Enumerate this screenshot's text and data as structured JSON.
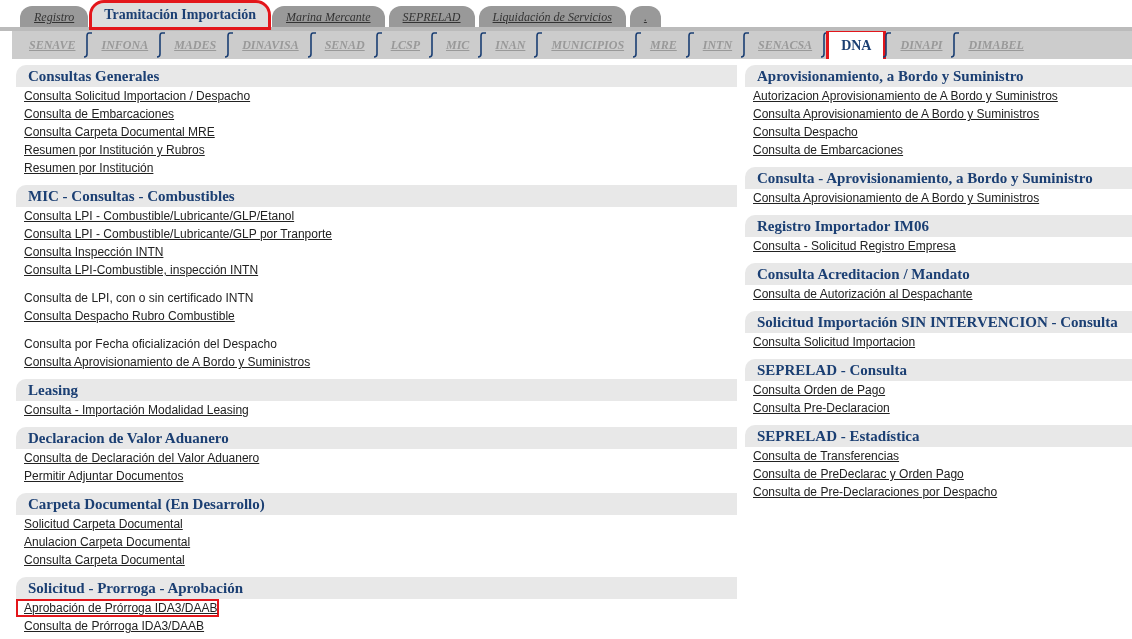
{
  "tabs": [
    {
      "label": "Registro",
      "selected": false,
      "highlighted": false
    },
    {
      "label": "Tramitación Importación",
      "selected": true,
      "highlighted": true
    },
    {
      "label": "Marina Mercante",
      "selected": false,
      "highlighted": false
    },
    {
      "label": "SEPRELAD",
      "selected": false,
      "highlighted": false
    },
    {
      "label": "Liquidación de Servicios",
      "selected": false,
      "highlighted": false
    },
    {
      "label": ".",
      "selected": false,
      "highlighted": false
    }
  ],
  "subtabs": [
    {
      "label": "SENAVE",
      "selected": false,
      "highlighted": false
    },
    {
      "label": "INFONA",
      "selected": false,
      "highlighted": false
    },
    {
      "label": "MADES",
      "selected": false,
      "highlighted": false
    },
    {
      "label": "DINAVISA",
      "selected": false,
      "highlighted": false
    },
    {
      "label": "SENAD",
      "selected": false,
      "highlighted": false
    },
    {
      "label": "LCSP",
      "selected": false,
      "highlighted": false
    },
    {
      "label": "MIC",
      "selected": false,
      "highlighted": false
    },
    {
      "label": "INAN",
      "selected": false,
      "highlighted": false
    },
    {
      "label": "MUNICIPIOS",
      "selected": false,
      "highlighted": false
    },
    {
      "label": "MRE",
      "selected": false,
      "highlighted": false
    },
    {
      "label": "INTN",
      "selected": false,
      "highlighted": false
    },
    {
      "label": "SENACSA",
      "selected": false,
      "highlighted": false
    },
    {
      "label": "DNA",
      "selected": true,
      "highlighted": true
    },
    {
      "label": "DINAPI",
      "selected": false,
      "highlighted": false
    },
    {
      "label": "DIMABEL",
      "selected": false,
      "highlighted": false
    }
  ],
  "columns": [
    {
      "sections": [
        {
          "title": "Consultas Generales",
          "items": [
            {
              "kind": "link",
              "text": "Consulta Solicitud Importacion / Despacho",
              "highlighted": false
            },
            {
              "kind": "link",
              "text": "Consulta de Embarcaciones",
              "highlighted": false
            },
            {
              "kind": "link",
              "text": "Consulta Carpeta Documental MRE",
              "highlighted": false
            },
            {
              "kind": "link",
              "text": "Resumen por Institución y Rubros",
              "highlighted": false
            },
            {
              "kind": "link",
              "text": "Resumen por Institución",
              "highlighted": false
            }
          ]
        },
        {
          "title": "MIC - Consultas - Combustibles",
          "items": [
            {
              "kind": "link",
              "text": "Consulta LPI - Combustible/Lubricante/GLP/Etanol",
              "highlighted": false
            },
            {
              "kind": "link",
              "text": "Consulta LPI - Combustible/Lubricante/GLP por Tranporte",
              "highlighted": false
            },
            {
              "kind": "link",
              "text": "Consulta Inspección INTN",
              "highlighted": false
            },
            {
              "kind": "link",
              "text": "Consulta LPI-Combustible, inspección INTN",
              "highlighted": false
            },
            {
              "kind": "text",
              "text": "Consulta de LPI, con o sin certificado INTN",
              "highlighted": false
            },
            {
              "kind": "link",
              "text": "Consulta Despacho Rubro Combustible",
              "highlighted": false
            },
            {
              "kind": "text",
              "text": "Consulta por Fecha oficialización del Despacho",
              "highlighted": false
            },
            {
              "kind": "link",
              "text": "Consulta Aprovisionamiento de A Bordo y Suministros",
              "highlighted": false
            }
          ]
        },
        {
          "title": "Leasing",
          "items": [
            {
              "kind": "link",
              "text": "Consulta - Importación Modalidad Leasing",
              "highlighted": false
            }
          ]
        },
        {
          "title": "Declaracion de Valor Aduanero",
          "items": [
            {
              "kind": "link",
              "text": "Consulta de Declaración del Valor Aduanero",
              "highlighted": false
            },
            {
              "kind": "link",
              "text": "Permitir Adjuntar Documentos",
              "highlighted": false
            }
          ]
        },
        {
          "title": "Carpeta Documental (En Desarrollo)",
          "items": [
            {
              "kind": "link",
              "text": "Solicitud Carpeta Documental",
              "highlighted": false
            },
            {
              "kind": "link",
              "text": "Anulacion Carpeta Documental",
              "highlighted": false
            },
            {
              "kind": "link",
              "text": "Consulta Carpeta Documental",
              "highlighted": false
            }
          ]
        },
        {
          "title": "Solicitud - Prorroga - Aprobación",
          "items": [
            {
              "kind": "link",
              "text": "Aprobación de Prórroga IDA3/DAAB",
              "highlighted": true
            },
            {
              "kind": "link",
              "text": "Consulta de Prórroga IDA3/DAAB",
              "highlighted": false
            }
          ]
        }
      ]
    },
    {
      "sections": [
        {
          "title": "Aprovisionamiento, a Bordo y Suministro",
          "items": [
            {
              "kind": "link",
              "text": "Autorizacion Aprovisionamiento de A Bordo y Suministros",
              "highlighted": false
            },
            {
              "kind": "link",
              "text": "Consulta Aprovisionamiento de A Bordo y Suministros",
              "highlighted": false
            },
            {
              "kind": "link",
              "text": "Consulta Despacho",
              "highlighted": false
            },
            {
              "kind": "link",
              "text": "Consulta de Embarcaciones",
              "highlighted": false
            }
          ]
        },
        {
          "title": "Consulta - Aprovisionamiento, a Bordo y Suministro",
          "items": [
            {
              "kind": "link",
              "text": "Consulta Aprovisionamiento de A Bordo y Suministros",
              "highlighted": false
            }
          ]
        },
        {
          "title": "Registro Importador IM06",
          "items": [
            {
              "kind": "link",
              "text": "Consulta - Solicitud Registro Empresa",
              "highlighted": false
            }
          ]
        },
        {
          "title": "Consulta Acreditacion / Mandato",
          "items": [
            {
              "kind": "link",
              "text": "Consulta de Autorización al Despachante",
              "highlighted": false
            }
          ]
        },
        {
          "title": "Solicitud Importación SIN INTERVENCION - Consulta",
          "items": [
            {
              "kind": "link",
              "text": "Consulta Solicitud Importacion",
              "highlighted": false
            }
          ]
        },
        {
          "title": "SEPRELAD - Consulta",
          "items": [
            {
              "kind": "link",
              "text": "Consulta Orden de Pago",
              "highlighted": false
            },
            {
              "kind": "link",
              "text": "Consulta Pre-Declaracion",
              "highlighted": false
            }
          ]
        },
        {
          "title": "SEPRELAD - Estadística",
          "items": [
            {
              "kind": "link",
              "text": "Consulta de Transferencias",
              "highlighted": false
            },
            {
              "kind": "link",
              "text": "Consulta de PreDeclarac y Orden Pago",
              "highlighted": false
            },
            {
              "kind": "link",
              "text": "Consulta de Pre-Declaraciones por Despacho",
              "highlighted": false
            }
          ]
        }
      ]
    }
  ]
}
